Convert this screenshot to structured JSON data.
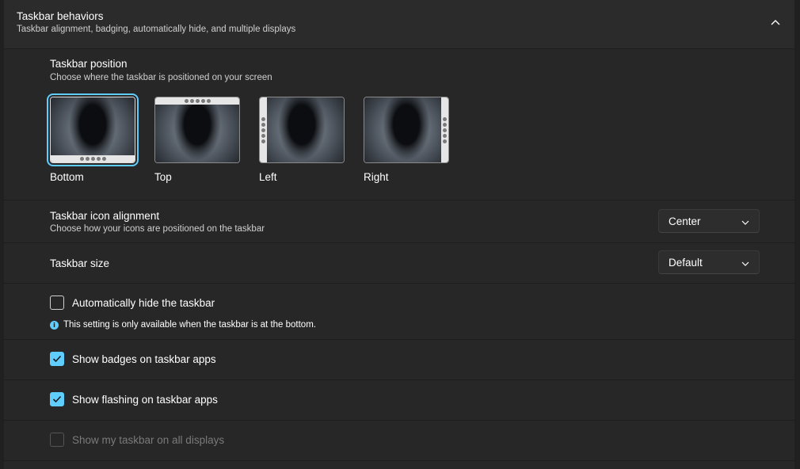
{
  "header": {
    "title": "Taskbar behaviors",
    "subtitle": "Taskbar alignment, badging, automatically hide, and multiple displays"
  },
  "position": {
    "title": "Taskbar position",
    "subtitle": "Choose where the taskbar is positioned on your screen",
    "selected": "Bottom",
    "options": [
      {
        "label": "Bottom"
      },
      {
        "label": "Top"
      },
      {
        "label": "Left"
      },
      {
        "label": "Right"
      }
    ]
  },
  "alignment": {
    "title": "Taskbar icon alignment",
    "subtitle": "Choose how your icons are positioned on the taskbar",
    "value": "Center"
  },
  "size": {
    "title": "Taskbar size",
    "value": "Default"
  },
  "autohide": {
    "label": "Automatically hide the taskbar",
    "checked": false,
    "info": "This setting is only available when the taskbar is at the bottom."
  },
  "badges": {
    "label": "Show badges on taskbar apps",
    "checked": true
  },
  "flashing": {
    "label": "Show flashing on taskbar apps",
    "checked": true
  },
  "all_displays": {
    "label": "Show my taskbar on all displays",
    "checked": false,
    "disabled": true
  },
  "colors": {
    "accent": "#60cdff",
    "card": "#2b2b2b",
    "background": "#202020"
  }
}
